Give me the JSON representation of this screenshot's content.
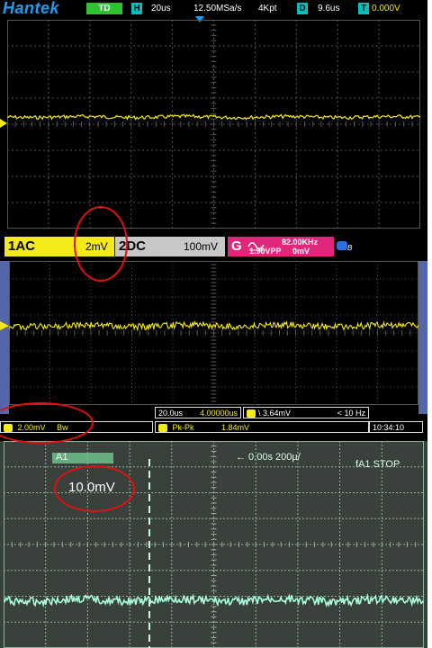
{
  "hantek": {
    "brand": "Hantek",
    "mode_badge": "TD",
    "timebase_letter": "H",
    "timebase": "20us",
    "sample_rate": "12.50MSa/s",
    "memory_depth": "4Kpt",
    "delay_letter": "D",
    "delay": "9.6us",
    "trigger_letter": "T",
    "trigger_level": "0.000V",
    "ch1_label": "1AC",
    "ch1_scale": "2mV",
    "ch2_label": "2DC",
    "ch2_scale": "100mV",
    "trig_label": "G",
    "trig_freq": "82.00KHz",
    "trig_vpp": "1.90VPP",
    "trig_offset": "0mV",
    "extra_icon_label": "B"
  },
  "scope2": {
    "ch1_scale": "2.00mV",
    "bw_label": "Bw",
    "timebase": "20.0us",
    "time_offset": "4.00000us",
    "trigger_channel": "1",
    "trigger_level": "3.64mV",
    "freq_readout": "< 10 Hz",
    "measure_label": "Pk-Pk",
    "measure_value": "1.84mV",
    "clock": "10:34:10"
  },
  "scope3": {
    "channel_header": "A1",
    "time_readout": "← 0.00s 200µ/",
    "trigger_readout": "fA1 STOP",
    "scale_annotation": "10.0mV"
  },
  "colors": {
    "ch1_yellow": "#f4ea1a",
    "grid_gray": "#555555",
    "trigger_pink": "#e0277a",
    "annotation_red": "#e01010",
    "analog_green": "#a8ffd8"
  }
}
